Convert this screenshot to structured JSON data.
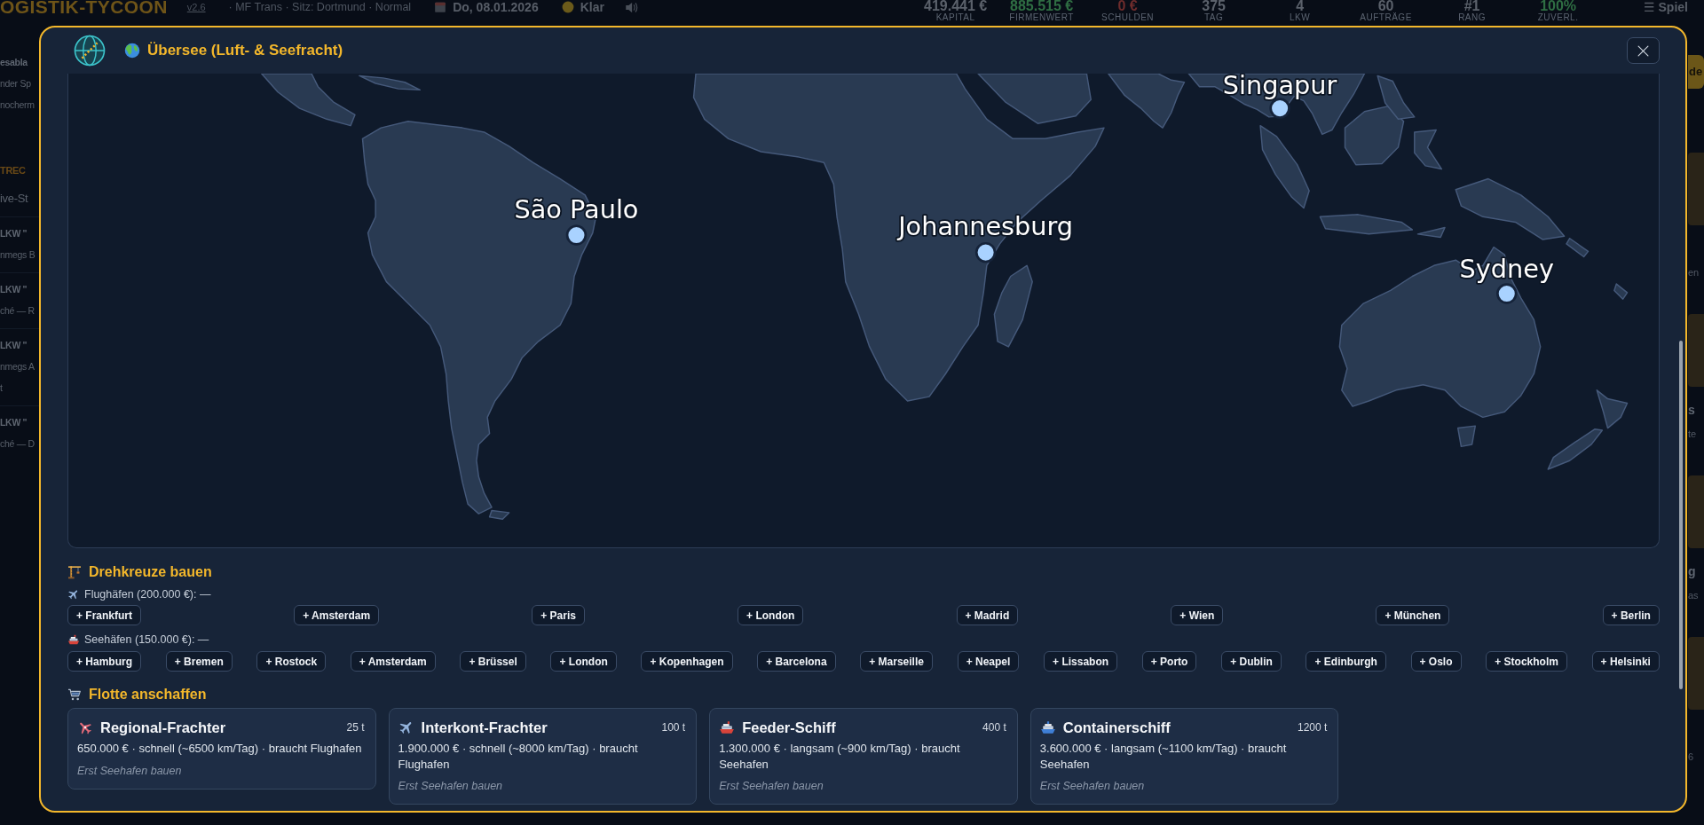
{
  "topbar": {
    "brand": "OGISTIK-TYCOON",
    "version": "v2.6",
    "company": "· MF Trans · Sitz: Dortmund · Normal",
    "date": "Do, 08.01.2026",
    "weather": "Klar",
    "stats": [
      {
        "value": "419.441 €",
        "label": "KAPITAL",
        "color": "#5b616b"
      },
      {
        "value": "885.515 €",
        "label": "FIRMENWERT",
        "color": "#2f6e43"
      },
      {
        "value": "0 €",
        "label": "SCHULDEN",
        "color": "#6e2c2c"
      },
      {
        "value": "375",
        "label": "TAG",
        "color": "#5b616b"
      },
      {
        "value": "4",
        "label": "LKW",
        "color": "#5b616b"
      },
      {
        "value": "60",
        "label": "AUFTRÄGE",
        "color": "#5b616b"
      },
      {
        "value": "#1",
        "label": "RANG",
        "color": "#5b616b"
      },
      {
        "value": "100%",
        "label": "ZUVERL.",
        "color": "#2f6e43"
      }
    ],
    "menu": "☰ Spiel"
  },
  "sidebar": {
    "card": {
      "title": "esabla",
      "lines": [
        "nder Sp",
        "nocherm"
      ]
    },
    "section": "TREC",
    "subtitle": "ive-St",
    "entries": [
      {
        "title": "LKW \"",
        "lines": [
          "nmegs B"
        ]
      },
      {
        "title": "LKW \"",
        "lines": [
          "ché — R"
        ]
      },
      {
        "title": "LKW \"",
        "lines": [
          "nmegs A",
          "t"
        ]
      },
      {
        "title": "LKW \"",
        "lines": [
          "ché — D"
        ]
      }
    ]
  },
  "right_panel": {
    "button": "de",
    "cards": [
      {
        "subtitle": "en"
      },
      {
        "title": "s",
        "subtitle": "te"
      },
      {
        "title": "g",
        "subtitle": "as"
      },
      {
        "subtitle": "6"
      }
    ]
  },
  "modal": {
    "title": "Übersee (Luft- & Seefracht)",
    "map": {
      "cities": [
        {
          "name": "Singapur"
        },
        {
          "name": "São Paulo"
        },
        {
          "name": "Johannesburg"
        },
        {
          "name": "Sydney"
        }
      ]
    },
    "hubs": {
      "title": "Drehkreuze bauen",
      "groups": [
        {
          "label": "Flughäfen (200.000 €): —",
          "buttons": [
            "+ Frankfurt",
            "+ Amsterdam",
            "+ Paris",
            "+ London",
            "+ Madrid",
            "+ Wien",
            "+ München",
            "+ Berlin"
          ]
        },
        {
          "label": "Seehäfen (150.000 €): —",
          "buttons": [
            "+ Hamburg",
            "+ Bremen",
            "+ Rostock",
            "+ Amsterdam",
            "+ Brüssel",
            "+ London",
            "+ Kopenhagen",
            "+ Barcelona",
            "+ Marseille",
            "+ Neapel",
            "+ Lissabon",
            "+ Porto",
            "+ Dublin",
            "+ Edinburgh",
            "+ Oslo",
            "+ Stockholm",
            "+ Helsinki"
          ]
        }
      ]
    },
    "fleet": {
      "title": "Flotte anschaffen",
      "vehicles": [
        {
          "name": "Regional-Frachter",
          "capacity": "25 t",
          "description": "650.000 € · schnell (~6500 km/Tag) · braucht Flughafen",
          "note": "Erst Seehafen bauen"
        },
        {
          "name": "Interkont-Frachter",
          "capacity": "100 t",
          "description": "1.900.000 € · schnell (~8000 km/Tag) · braucht Flughafen",
          "note": "Erst Seehafen bauen"
        },
        {
          "name": "Feeder-Schiff",
          "capacity": "400 t",
          "description": "1.300.000 € · langsam (~900 km/Tag) · braucht Seehafen",
          "note": "Erst Seehafen bauen"
        },
        {
          "name": "Containerschiff",
          "capacity": "1200 t",
          "description": "3.600.000 € · langsam (~1100 km/Tag) · braucht Seehafen",
          "note": "Erst Seehafen bauen"
        }
      ]
    }
  }
}
